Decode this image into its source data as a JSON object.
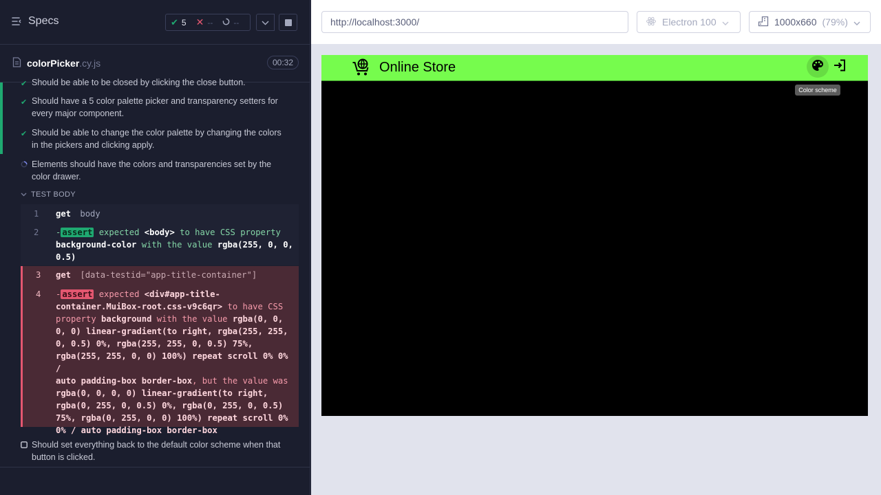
{
  "reporter": {
    "specs_label": "Specs",
    "stats": {
      "passed": "5",
      "failed": "--",
      "pending": "--"
    },
    "file": {
      "base": "colorPicker",
      "ext": ".cy.js",
      "duration": "00:32"
    },
    "tests": [
      {
        "title": "Should be able to be closed by clicking the close button.",
        "state": "passed"
      },
      {
        "title": "Should have a 5 color palette picker and transparency setters for every major component.",
        "state": "passed"
      },
      {
        "title": "Should be able to change the color palette by changing the colors in the pickers and clicking apply.",
        "state": "passed"
      },
      {
        "title": "Elements should have the colors and transparencies set by the color drawer.",
        "state": "running"
      }
    ],
    "test_body_label": "TEST BODY",
    "commands": [
      {
        "num": "1",
        "name": "get",
        "arg": "body"
      },
      {
        "num": "2",
        "prefix": "-",
        "name": "assert",
        "parts": [
          "expected",
          "<body>",
          "to have CSS property",
          "background-color",
          "with the value",
          "rgba(255, 0, 0,",
          "0.5)"
        ]
      },
      {
        "num": "3",
        "name": "get",
        "arg": "[data-testid=\"app-title-container\"]"
      },
      {
        "num": "4",
        "prefix": "-",
        "name": "assert",
        "lines": [
          "expected",
          "<div#app-title-",
          "container.MuiBox-root.css-v9c6qr>",
          "to have CSS",
          "property",
          "background",
          "with the value",
          "rgba(0, 0,",
          "0, 0) linear-gradient(to right, rgba(255, 255,",
          "0, 0.5) 0%, rgba(255, 255, 0, 0.5) 75%,",
          "rgba(255, 255, 0, 0) 100%) repeat scroll 0% 0% /",
          "auto padding-box border-box",
          ", but the value was",
          "rgba(0, 0, 0, 0) linear-gradient(to right,",
          "rgba(0, 255, 0, 0.5) 0%, rgba(0, 255, 0, 0.5)",
          "75%, rgba(0, 255, 0, 0) 100%) repeat scroll 0%",
          "0% / auto padding-box border-box"
        ]
      }
    ],
    "pending_test": "Should set everything back to the default color scheme when that button is clicked."
  },
  "browser": {
    "url": "http://localhost:3000/",
    "browser_name": "Electron 100",
    "viewport": "1000x660",
    "zoom": "(79%)"
  },
  "app": {
    "title": "Online Store",
    "tooltip": "Color scheme",
    "bar_color": "#76fc4d",
    "body_color": "#000000"
  },
  "colors": {
    "pass": "#1fa971",
    "fail": "#e45770"
  }
}
